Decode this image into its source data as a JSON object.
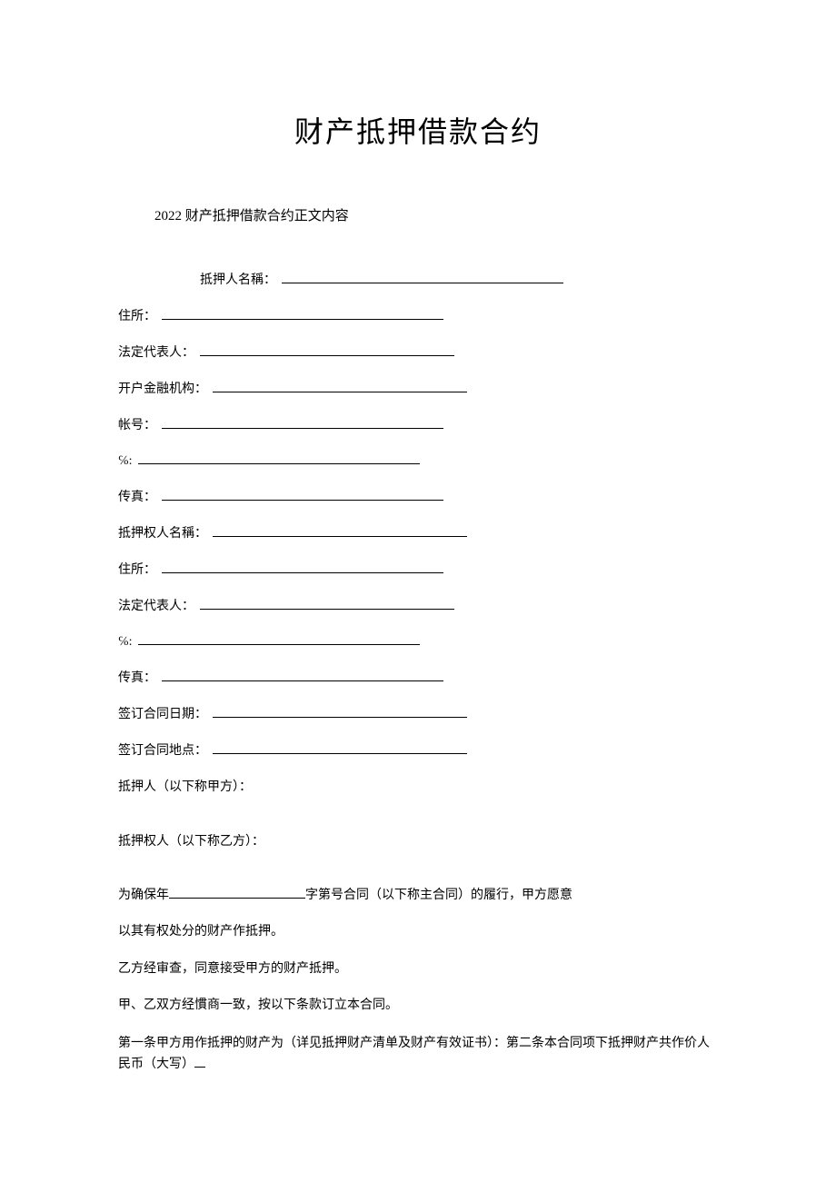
{
  "title": "财产抵押借款合约",
  "subtitle": "2022 财产抵押借款合约正文内容",
  "fields": {
    "mortgagor_name": "抵押人名稱：",
    "address1": "住所：",
    "legal_rep1": "法定代表人：",
    "bank": "开户金融机构：",
    "account": "帐号：",
    "phone1": "℅:",
    "fax1": "传真：",
    "mortgagee_name": "抵押权人名稱：",
    "address2": "住所：",
    "legal_rep2": "法定代表人：",
    "phone2": "℅:",
    "fax2": "传真：",
    "sign_date": "签订合同日期：",
    "sign_place": "签订合同地点："
  },
  "parties": {
    "party_a": "抵押人（以下称甲方）：",
    "party_b": "抵押权人（以下称乙方）："
  },
  "body": {
    "line1_prefix": "为确保年",
    "line1_suffix": "字第号合同（以下称主合同）的履行，甲方愿意",
    "line2": "以其有权处分的财产作抵押。",
    "line3": "乙方经审查，同意接受甲方的财产抵押。",
    "line4": "甲、乙双方经慣商一致，按以下条款订立本合同。",
    "line5": "第一条甲方用作抵押的财产为（详见抵押财产清单及财产有效证书）：第二条本合同项下抵押财产共作价人民币（大写）"
  }
}
